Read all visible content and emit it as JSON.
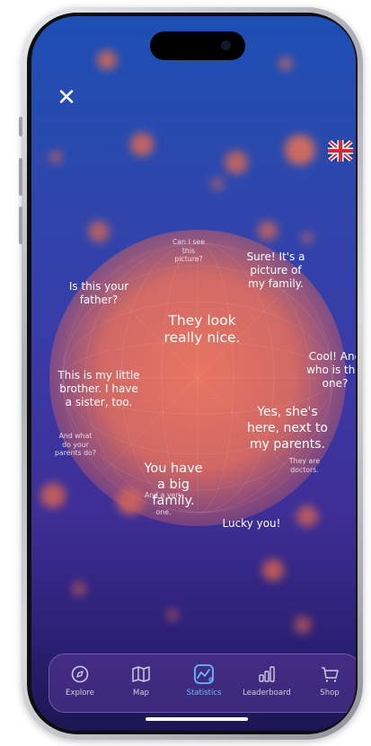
{
  "header": {
    "close_icon": "close-icon",
    "language_flag": "uk-flag-icon"
  },
  "phrases": {
    "can_i_see": "Can I see\nthis\npicture?",
    "sure": "Sure! It's a\npicture of\nmy family.",
    "is_this_father": "Is this your\nfather?",
    "they_look": "They look\nreally nice.",
    "little_brother": "This is my little\nbrother. I have\na sister, too.",
    "cool": "Cool! And\nwho is this\none?",
    "yes_shes": "Yes, she's\nhere, next to\nmy parents.",
    "what_parents": "And what\ndo your\nparents do?",
    "they_are_doctors": "They are\ndoctors.",
    "big_family": "You have\na big\nfamily.",
    "and_a_very": "And a very\n\none.",
    "lucky_you": "Lucky you!"
  },
  "nav": {
    "items": [
      {
        "label": "Explore",
        "icon": "compass-icon"
      },
      {
        "label": "Map",
        "icon": "map-icon"
      },
      {
        "label": "Statistics",
        "icon": "statistics-icon"
      },
      {
        "label": "Leaderboard",
        "icon": "leaderboard-icon"
      },
      {
        "label": "Shop",
        "icon": "cart-icon"
      }
    ],
    "active": "Statistics"
  },
  "colors": {
    "accent": "#6fb2ff",
    "globe": "#e8725f",
    "background_top": "#1d4fb4",
    "background_bottom": "#1b1652"
  }
}
